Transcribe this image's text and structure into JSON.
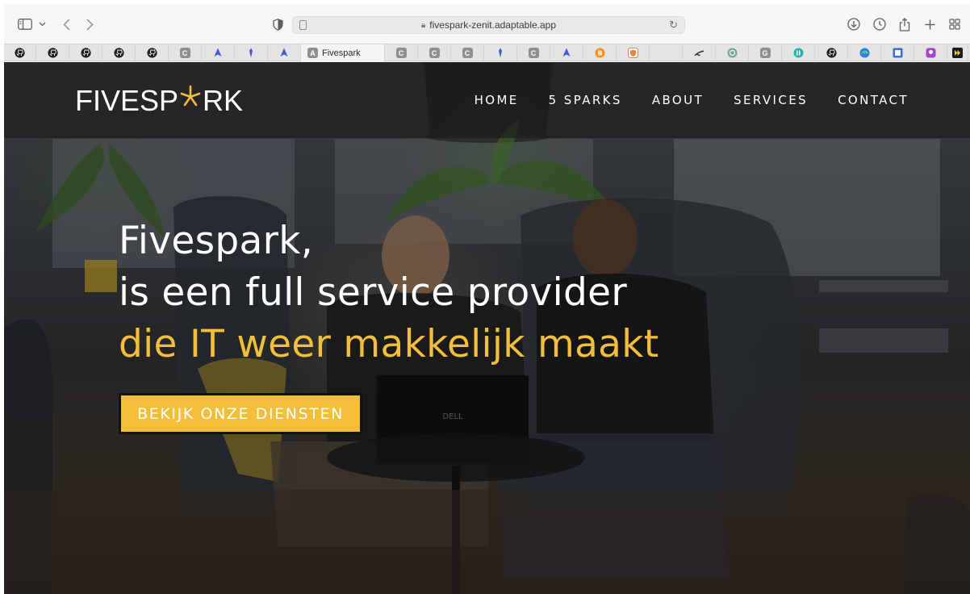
{
  "browser": {
    "url": "fivespark-zenit.adaptable.app",
    "active_tab_title": "Fivespark",
    "tabs": [
      {
        "icon": "github-icon",
        "letter": "",
        "color": "#1b1f23"
      },
      {
        "icon": "github-icon",
        "letter": "",
        "color": "#1b1f23"
      },
      {
        "icon": "github-icon",
        "letter": "",
        "color": "#1b1f23"
      },
      {
        "icon": "github-icon",
        "letter": "",
        "color": "#1b1f23"
      },
      {
        "icon": "github-icon",
        "letter": "",
        "color": "#1b1f23"
      },
      {
        "icon": "letter-icon",
        "letter": "C",
        "color": "#8e8e93"
      },
      {
        "icon": "rocket-icon",
        "letter": "",
        "color": "#3f5bd6"
      },
      {
        "icon": "pin-icon",
        "letter": "",
        "color": "#3f5bd6"
      },
      {
        "icon": "rocket-icon",
        "letter": "",
        "color": "#3f5bd6"
      },
      {
        "icon": "active",
        "letter": "A",
        "color": "#8e8e93"
      },
      {
        "icon": "letter-icon",
        "letter": "C",
        "color": "#8e8e93"
      },
      {
        "icon": "letter-icon",
        "letter": "C",
        "color": "#8e8e93"
      },
      {
        "icon": "letter-icon",
        "letter": "C",
        "color": "#8e8e93"
      },
      {
        "icon": "pin-icon",
        "letter": "",
        "color": "#3f5bd6"
      },
      {
        "icon": "letter-icon",
        "letter": "C",
        "color": "#8e8e93"
      },
      {
        "icon": "rocket-icon",
        "letter": "",
        "color": "#3f5bd6"
      },
      {
        "icon": "bitcoin-icon",
        "letter": "",
        "color": "#f7931a"
      },
      {
        "icon": "shield-icon",
        "letter": "",
        "color": "#e8834c"
      },
      {
        "icon": "blank-tab",
        "letter": "",
        "color": "#e4e4e4"
      },
      {
        "icon": "swimmer-icon",
        "letter": "",
        "color": "#333333"
      },
      {
        "icon": "openai-icon",
        "letter": "",
        "color": "#74aa9c"
      },
      {
        "icon": "letter-icon",
        "letter": "G",
        "color": "#8e8e93"
      },
      {
        "icon": "circle-icon",
        "letter": "",
        "color": "#2bb5a8"
      },
      {
        "icon": "github-icon",
        "letter": "",
        "color": "#1b1f23"
      },
      {
        "icon": "edge-icon",
        "letter": "",
        "color": "#2a7de1"
      },
      {
        "icon": "image-icon",
        "letter": "",
        "color": "#3c6fd8"
      },
      {
        "icon": "badge-icon",
        "letter": "",
        "color": "#a347c7"
      },
      {
        "icon": "ff-icon",
        "letter": "",
        "color": "#1a1a1a"
      }
    ]
  },
  "site": {
    "logo_left": "FIVESP",
    "logo_right": "RK",
    "accent_color": "#f3bf3a",
    "nav": [
      "HOME",
      "5 SPARKS",
      "ABOUT",
      "SERVICES",
      "CONTACT"
    ],
    "hero": {
      "line1": "Fivespark,",
      "line2": "is een full service provider",
      "line3": "die IT weer makkelijk maakt"
    },
    "cta": "BEKIJK ONZE DIENSTEN"
  }
}
